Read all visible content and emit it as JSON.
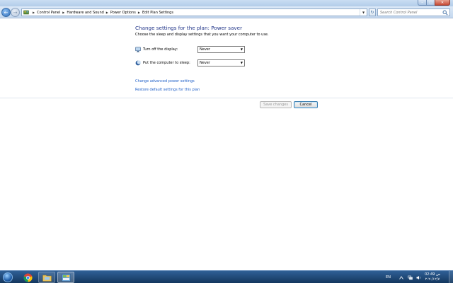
{
  "address_bar": {
    "breadcrumbs": [
      "Control Panel",
      "Hardware and Sound",
      "Power Options",
      "Edit Plan Settings"
    ]
  },
  "search": {
    "placeholder": "Search Control Panel"
  },
  "main": {
    "heading": "Change settings for the plan: Power saver",
    "subtitle": "Choose the sleep and display settings that you want your computer to use.",
    "display_setting": {
      "label": "Turn off the display:",
      "value": "Never"
    },
    "sleep_setting": {
      "label": "Put the computer to sleep:",
      "value": "Never"
    },
    "links": {
      "advanced": "Change advanced power settings",
      "restore": "Restore default settings for this plan"
    },
    "buttons": {
      "save": "Save changes",
      "cancel": "Cancel"
    }
  },
  "taskbar": {
    "language": "EN",
    "clock": {
      "time": "02:49 ص",
      "date": "۲-۲-/۱۲/۷"
    }
  },
  "colors": {
    "heading": "#1e3287",
    "link": "#1d5ec7",
    "taskbar": "#1f4a7c"
  }
}
